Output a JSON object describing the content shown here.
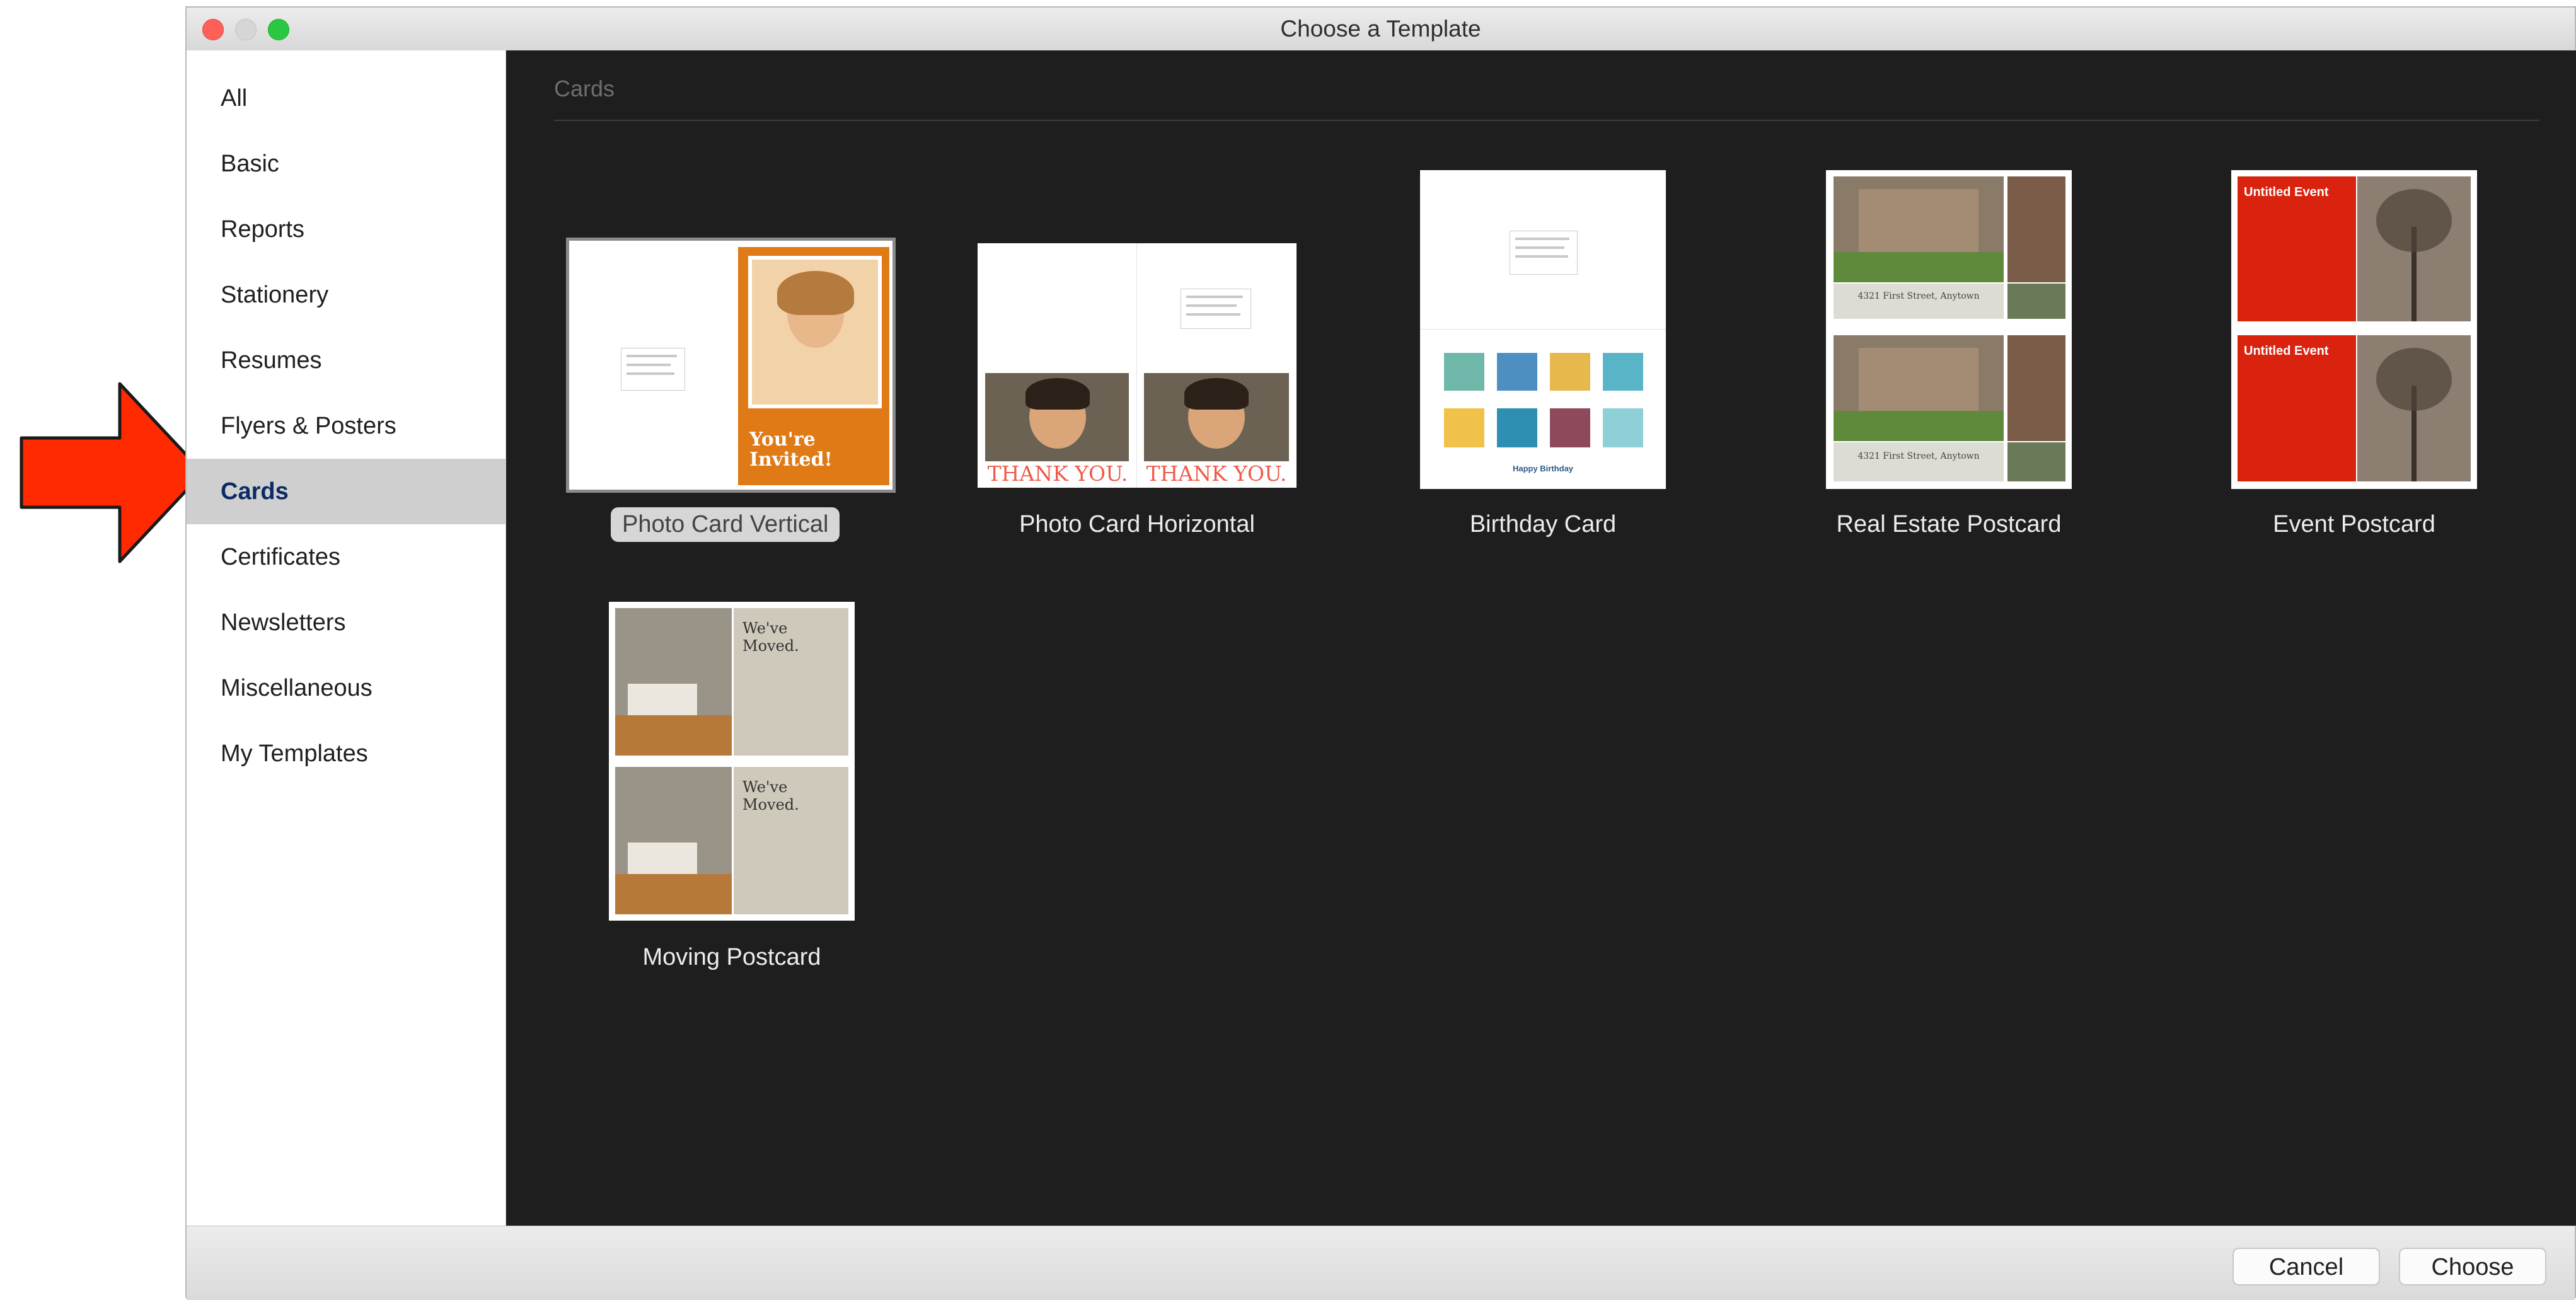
{
  "window": {
    "title": "Choose a Template"
  },
  "sidebar": {
    "items": [
      {
        "label": "All"
      },
      {
        "label": "Basic"
      },
      {
        "label": "Reports"
      },
      {
        "label": "Stationery"
      },
      {
        "label": "Resumes"
      },
      {
        "label": "Flyers & Posters"
      },
      {
        "label": "Cards",
        "selected": true
      },
      {
        "label": "Certificates"
      },
      {
        "label": "Newsletters"
      },
      {
        "label": "Miscellaneous"
      },
      {
        "label": "My Templates"
      }
    ]
  },
  "content": {
    "section_title": "Cards",
    "templates": [
      {
        "label": "Photo Card Vertical",
        "selected": true,
        "thumb_text": "You're Invited!"
      },
      {
        "label": "Photo Card Horizontal",
        "thumb_text_left": "THANK YOU.",
        "thumb_text_right": "THANK YOU."
      },
      {
        "label": "Birthday Card",
        "thumb_text": "Happy Birthday"
      },
      {
        "label": "Real Estate Postcard",
        "thumb_text_top": "4321 First Street, Anytown",
        "thumb_text_bottom": "4321 First Street, Anytown"
      },
      {
        "label": "Event Postcard",
        "thumb_text_top": "Untitled Event",
        "thumb_text_bottom": "Untitled Event"
      },
      {
        "label": "Moving Postcard",
        "thumb_text_top": "We've Moved.",
        "thumb_text_bottom": "We've Moved."
      }
    ]
  },
  "footer": {
    "cancel_label": "Cancel",
    "choose_label": "Choose"
  },
  "colors": {
    "selected_sidebar_bg": "#cfcfcf",
    "selected_sidebar_text": "#0b2a66",
    "content_bg": "#1e1e1e",
    "arrow": "#ff2a00",
    "invite_orange": "#e3781a",
    "event_red": "#d9230f"
  }
}
